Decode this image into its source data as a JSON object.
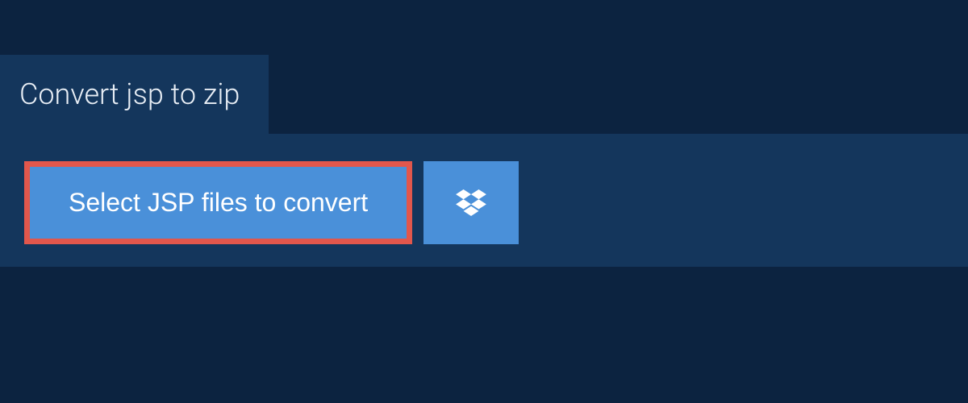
{
  "tab": {
    "title": "Convert jsp to zip"
  },
  "upload": {
    "select_label": "Select JSP files to convert"
  },
  "colors": {
    "background": "#0c2340",
    "panel": "#14365c",
    "button": "#4a90d9",
    "highlight_border": "#e2574c",
    "text": "#ffffff"
  }
}
